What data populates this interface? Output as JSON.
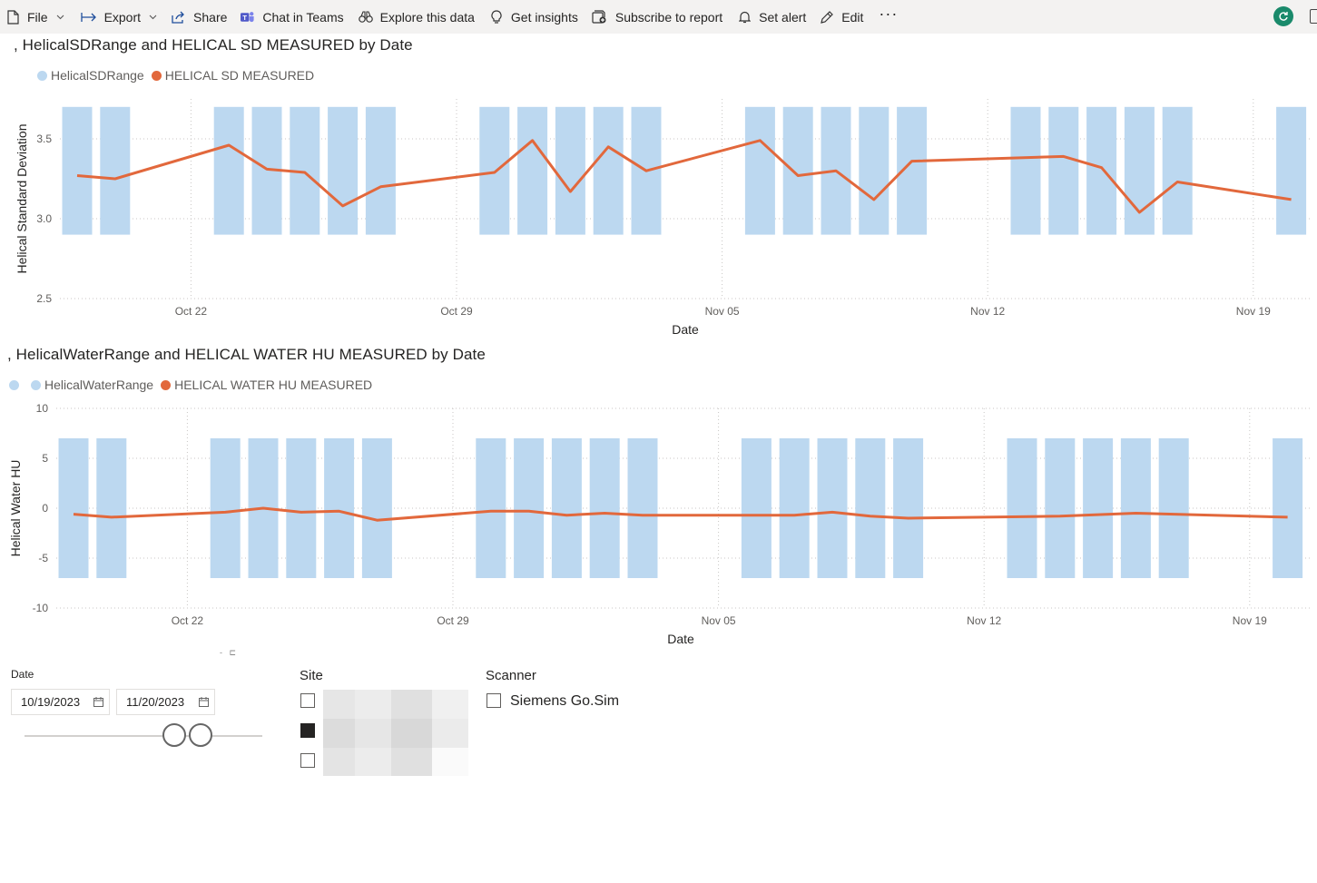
{
  "toolbar": {
    "items": [
      {
        "key": "file",
        "label": "File",
        "icon": "file-icon",
        "chevron": true
      },
      {
        "key": "export",
        "label": "Export",
        "icon": "export-icon",
        "chevron": true
      },
      {
        "key": "share",
        "label": "Share",
        "icon": "share-icon"
      },
      {
        "key": "chat",
        "label": "Chat in Teams",
        "icon": "teams-icon"
      },
      {
        "key": "explore",
        "label": "Explore this data",
        "icon": "binoculars-icon"
      },
      {
        "key": "insights",
        "label": "Get insights",
        "icon": "lightbulb-icon"
      },
      {
        "key": "subscribe",
        "label": "Subscribe to report",
        "icon": "subscribe-icon"
      },
      {
        "key": "alert",
        "label": "Set alert",
        "icon": "bell-icon"
      },
      {
        "key": "edit",
        "label": "Edit",
        "icon": "pencil-icon"
      }
    ],
    "more_label": "···"
  },
  "colors": {
    "range": "#bcd8f0",
    "line": "#e2683c",
    "accent": "#1a8a6b"
  },
  "chart_data": [
    {
      "type": "bar+line",
      "title": ", HelicalSDRange and HELICAL SD MEASURED by Date",
      "legend": [
        "HelicalSDRange",
        "HELICAL SD MEASURED"
      ],
      "xlabel": "Date",
      "ylabel": "Helical Standard Deviation",
      "yticks": [
        2.5,
        3.0,
        3.5
      ],
      "ylim": [
        2.5,
        3.75
      ],
      "x_range": [
        "2023-10-19",
        "2023-11-20"
      ],
      "x_ticks": [
        {
          "label": "Oct 22",
          "date": "2023-10-22"
        },
        {
          "label": "Oct 29",
          "date": "2023-10-29"
        },
        {
          "label": "Nov 05",
          "date": "2023-11-05"
        },
        {
          "label": "Nov 12",
          "date": "2023-11-12"
        },
        {
          "label": "Nov 19",
          "date": "2023-11-19"
        }
      ],
      "range_band": {
        "low": 2.9,
        "high": 3.7
      },
      "range_dates": [
        "2023-10-19",
        "2023-10-20",
        "2023-10-23",
        "2023-10-24",
        "2023-10-25",
        "2023-10-26",
        "2023-10-27",
        "2023-10-30",
        "2023-10-31",
        "2023-11-01",
        "2023-11-02",
        "2023-11-03",
        "2023-11-06",
        "2023-11-07",
        "2023-11-08",
        "2023-11-09",
        "2023-11-10",
        "2023-11-13",
        "2023-11-14",
        "2023-11-15",
        "2023-11-16",
        "2023-11-17",
        "2023-11-20"
      ],
      "series": [
        {
          "name": "HELICAL SD MEASURED",
          "points": [
            [
              "2023-10-19",
              3.27
            ],
            [
              "2023-10-20",
              3.25
            ],
            [
              "2023-10-23",
              3.46
            ],
            [
              "2023-10-24",
              3.31
            ],
            [
              "2023-10-25",
              3.29
            ],
            [
              "2023-10-26",
              3.08
            ],
            [
              "2023-10-27",
              3.2
            ],
            [
              "2023-10-30",
              3.29
            ],
            [
              "2023-10-31",
              3.49
            ],
            [
              "2023-11-01",
              3.17
            ],
            [
              "2023-11-02",
              3.45
            ],
            [
              "2023-11-03",
              3.3
            ],
            [
              "2023-11-06",
              3.49
            ],
            [
              "2023-11-07",
              3.27
            ],
            [
              "2023-11-08",
              3.3
            ],
            [
              "2023-11-09",
              3.12
            ],
            [
              "2023-11-10",
              3.36
            ],
            [
              "2023-11-14",
              3.39
            ],
            [
              "2023-11-15",
              3.32
            ],
            [
              "2023-11-16",
              3.04
            ],
            [
              "2023-11-17",
              3.23
            ],
            [
              "2023-11-20",
              3.12
            ]
          ]
        }
      ]
    },
    {
      "type": "bar+line",
      "title": ", HelicalWaterRange and HELICAL WATER HU MEASURED by Date",
      "legend": [
        "HelicalWaterRange",
        "HELICAL WATER HU MEASURED"
      ],
      "xlabel": "Date",
      "ylabel": "Helical Water HU",
      "yticks": [
        -10,
        -5,
        0,
        5,
        10
      ],
      "ylim": [
        -10,
        10
      ],
      "x_range": [
        "2023-10-19",
        "2023-11-20"
      ],
      "x_ticks": [
        {
          "label": "Oct 22",
          "date": "2023-10-22"
        },
        {
          "label": "Oct 29",
          "date": "2023-10-29"
        },
        {
          "label": "Nov 05",
          "date": "2023-11-05"
        },
        {
          "label": "Nov 12",
          "date": "2023-11-12"
        },
        {
          "label": "Nov 19",
          "date": "2023-11-19"
        }
      ],
      "range_band": {
        "low": -7,
        "high": 7
      },
      "range_dates": [
        "2023-10-19",
        "2023-10-20",
        "2023-10-23",
        "2023-10-24",
        "2023-10-25",
        "2023-10-26",
        "2023-10-27",
        "2023-10-30",
        "2023-10-31",
        "2023-11-01",
        "2023-11-02",
        "2023-11-03",
        "2023-11-06",
        "2023-11-07",
        "2023-11-08",
        "2023-11-09",
        "2023-11-10",
        "2023-11-13",
        "2023-11-14",
        "2023-11-15",
        "2023-11-16",
        "2023-11-17",
        "2023-11-20"
      ],
      "series": [
        {
          "name": "HELICAL WATER HU MEASURED",
          "points": [
            [
              "2023-10-19",
              -0.6
            ],
            [
              "2023-10-20",
              -0.9
            ],
            [
              "2023-10-23",
              -0.4
            ],
            [
              "2023-10-24",
              0.0
            ],
            [
              "2023-10-25",
              -0.4
            ],
            [
              "2023-10-26",
              -0.3
            ],
            [
              "2023-10-27",
              -1.2
            ],
            [
              "2023-10-30",
              -0.3
            ],
            [
              "2023-10-31",
              -0.3
            ],
            [
              "2023-11-01",
              -0.7
            ],
            [
              "2023-11-02",
              -0.5
            ],
            [
              "2023-11-03",
              -0.7
            ],
            [
              "2023-11-06",
              -0.7
            ],
            [
              "2023-11-07",
              -0.7
            ],
            [
              "2023-11-08",
              -0.4
            ],
            [
              "2023-11-09",
              -0.8
            ],
            [
              "2023-11-10",
              -1.0
            ],
            [
              "2023-11-14",
              -0.8
            ],
            [
              "2023-11-16",
              -0.5
            ],
            [
              "2023-11-20",
              -0.9
            ]
          ]
        }
      ]
    }
  ],
  "date_slicer": {
    "label": "Date",
    "start": "10/19/2023",
    "end": "11/20/2023"
  },
  "site_slicer": {
    "title": "Site",
    "options": [
      {
        "checked": false
      },
      {
        "checked": true
      },
      {
        "checked": false
      }
    ]
  },
  "scanner_slicer": {
    "title": "Scanner",
    "options": [
      {
        "label": "Siemens Go.Sim",
        "checked": false
      }
    ]
  }
}
